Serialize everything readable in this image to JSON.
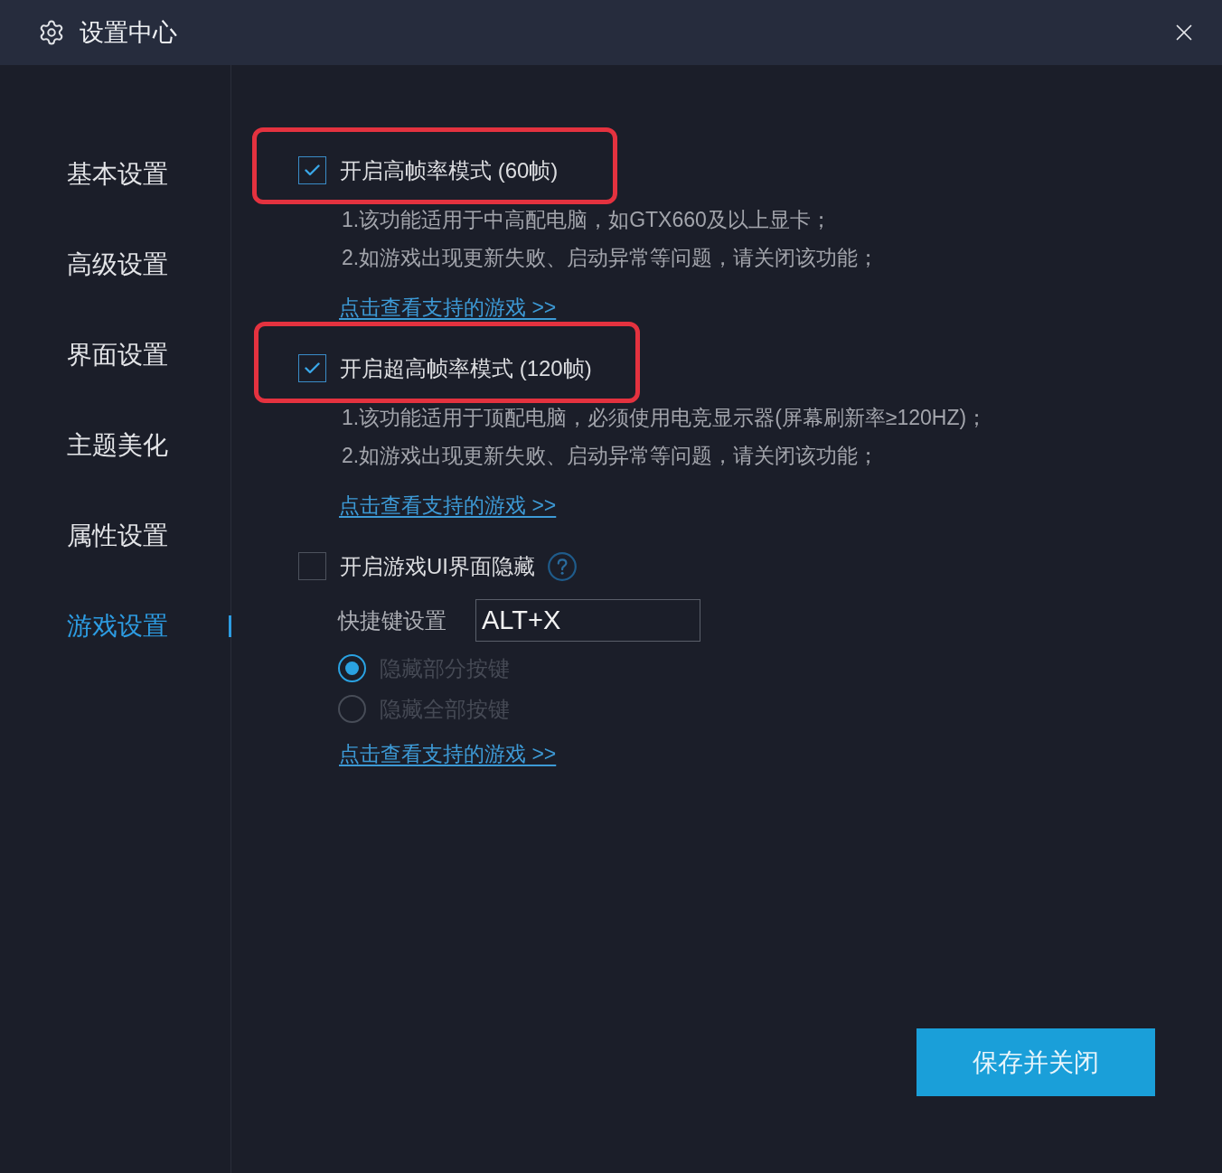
{
  "window": {
    "title": "设置中心"
  },
  "sidebar": {
    "items": [
      {
        "label": "基本设置",
        "selected": false
      },
      {
        "label": "高级设置",
        "selected": false
      },
      {
        "label": "界面设置",
        "selected": false
      },
      {
        "label": "主题美化",
        "selected": false
      },
      {
        "label": "属性设置",
        "selected": false
      },
      {
        "label": "游戏设置",
        "selected": true
      }
    ]
  },
  "options": [
    {
      "kind": "checkbox",
      "label": "开启高帧率模式 (60帧)",
      "checked": true,
      "highlighted": true,
      "notes": [
        "1.该功能适用于中高配电脑，如GTX660及以上显卡；",
        "2.如游戏出现更新失败、启动异常等问题，请关闭该功能；"
      ],
      "link": "点击查看支持的游戏 >>"
    },
    {
      "kind": "checkbox",
      "label": "开启超高帧率模式 (120帧)",
      "checked": true,
      "highlighted": true,
      "notes": [
        "1.该功能适用于顶配电脑，必须使用电竞显示器(屏幕刷新率≥120HZ)；",
        "2.如游戏出现更新失败、启动异常等问题，请关闭该功能；"
      ],
      "link": "点击查看支持的游戏 >>"
    },
    {
      "kind": "checkbox",
      "label": "开启游戏UI界面隐藏",
      "checked": false,
      "highlighted": false,
      "help_icon": true,
      "hotkey": {
        "label": "快捷键设置",
        "value": "ALT+X"
      },
      "choices": [
        {
          "label": "隐藏部分按键",
          "selected": true,
          "disabled": true
        },
        {
          "label": "隐藏全部按键",
          "selected": false,
          "disabled": true
        }
      ],
      "link": "点击查看支持的游戏 >>"
    }
  ],
  "save_button": "保存并关闭"
}
